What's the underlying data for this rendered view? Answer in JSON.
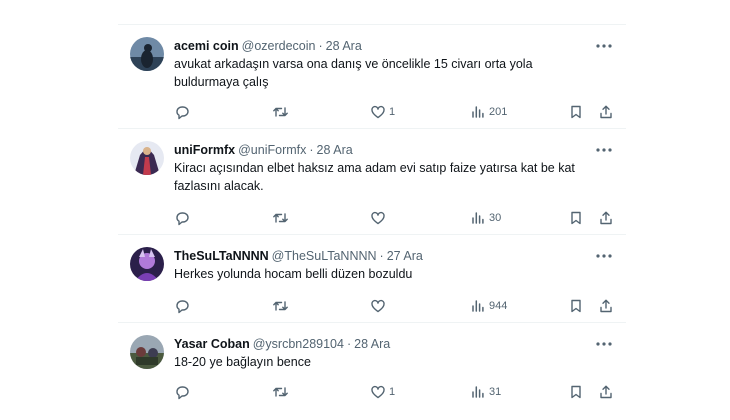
{
  "tweets": [
    {
      "name": "acemi coin",
      "handle": "@ozerdecoin",
      "separator": "·",
      "date": "28 Ara",
      "text": "avukat arkadaşın varsa ona danış ve öncelikle 15 civarı orta yola buldurmaya çalış",
      "replies": "",
      "retweets": "",
      "likes": "1",
      "views": "201"
    },
    {
      "name": "uniFormfx",
      "handle": "@uniFormfx",
      "separator": "·",
      "date": "28 Ara",
      "text": "Kiracı açısından elbet haksız ama adam evi satıp faize yatırsa kat be kat fazlasını alacak.",
      "replies": "",
      "retweets": "",
      "likes": "",
      "views": "30"
    },
    {
      "name": "TheSuLTaNNNN",
      "handle": "@TheSuLTaNNNN",
      "separator": "·",
      "date": "27 Ara",
      "text": "Herkes yolunda hocam belli düzen bozuldu",
      "replies": "",
      "retweets": "",
      "likes": "",
      "views": "944"
    },
    {
      "name": "Yasar Coban",
      "handle": "@ysrcbn289104",
      "separator": "·",
      "date": "28 Ara",
      "text": "18-20 ye bağlayın bence",
      "replies": "",
      "retweets": "",
      "likes": "1",
      "views": "31"
    }
  ],
  "icons": {
    "reply": "reply-icon",
    "retweet": "retweet-icon",
    "like": "like-icon",
    "views": "views-icon",
    "bookmark": "bookmark-icon",
    "share": "share-icon",
    "more": "more-icon"
  },
  "colors": {
    "secondary_text": "#536471",
    "primary_text": "#0f1419",
    "divider": "#eff3f4"
  }
}
